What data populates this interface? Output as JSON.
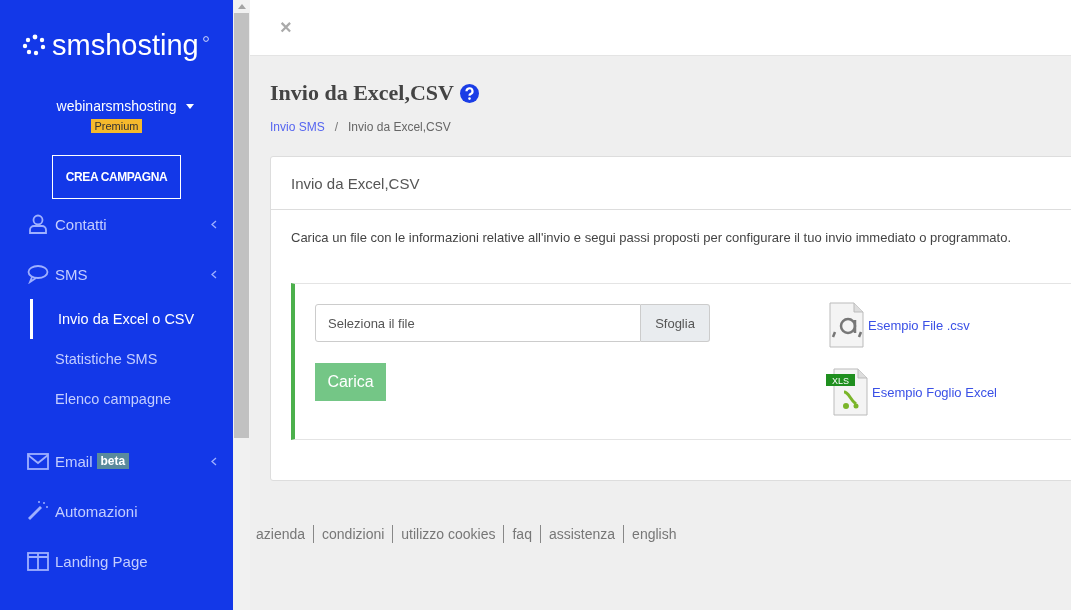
{
  "sidebar": {
    "logo": "smshosting",
    "account": {
      "name": "webinarsmshosting",
      "plan": "Premium"
    },
    "cta": "CREA CAMPAGNA",
    "items": [
      {
        "kind": "user",
        "label": "Contatti",
        "expandable": true
      },
      {
        "kind": "chat",
        "label": "SMS",
        "expandable": true,
        "children": [
          {
            "label": "Invio da Excel o CSV",
            "selected": true
          },
          {
            "label": "Statistiche SMS",
            "selected": false
          },
          {
            "label": "Elenco campagne",
            "selected": false
          }
        ]
      },
      {
        "kind": "mail",
        "label": "Email",
        "badge": "beta",
        "expandable": true
      },
      {
        "kind": "wand",
        "label": "Automazioni",
        "expandable": false
      },
      {
        "kind": "columns",
        "label": "Landing Page",
        "expandable": false
      }
    ]
  },
  "topbar": {
    "close": "×"
  },
  "page": {
    "title": "Invio da Excel,CSV",
    "breadcrumb_separator": "/",
    "breadcrumb": [
      {
        "label": "Invio SMS",
        "link": true
      },
      {
        "label": "Invio da Excel,CSV",
        "link": false
      }
    ]
  },
  "card": {
    "title": "Invio da Excel,CSV",
    "description": "Carica un file con le informazioni relative all'invio e segui passi proposti per configurare il tuo invio immediato o programmato.",
    "file_field": {
      "placeholder": "Seleziona il file",
      "browse": "Sfoglia"
    },
    "upload": "Carica",
    "examples": [
      {
        "kind": "csv",
        "label": "Esempio File .csv"
      },
      {
        "kind": "xls",
        "label": "Esempio Foglio Excel",
        "icon_text": "XLS"
      }
    ]
  },
  "footer": [
    "azienda",
    "condizioni",
    "utilizzo cookies",
    "faq",
    "assistenza",
    "english"
  ]
}
